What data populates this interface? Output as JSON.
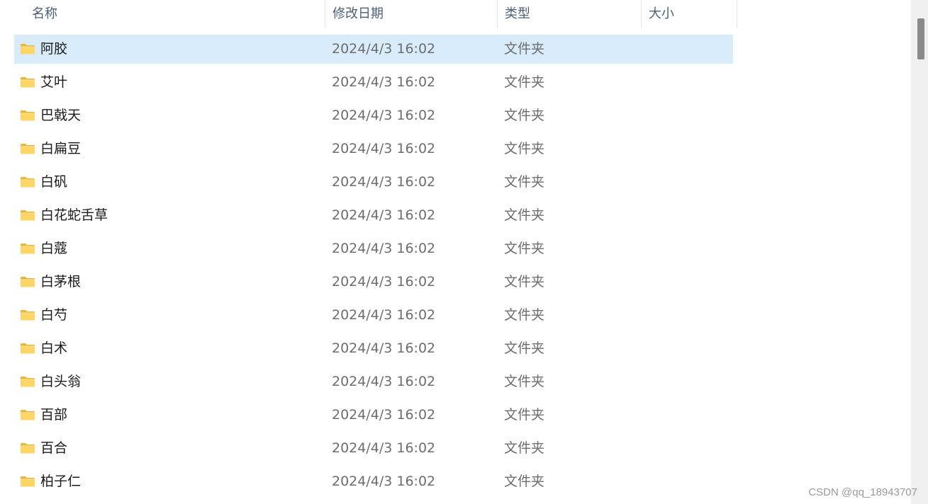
{
  "columns": {
    "name": "名称",
    "date": "修改日期",
    "type": "类型",
    "size": "大小"
  },
  "sort_indicator": "^",
  "rows": [
    {
      "name": "阿胶",
      "date": "2024/4/3 16:02",
      "type": "文件夹",
      "selected": true
    },
    {
      "name": "艾叶",
      "date": "2024/4/3 16:02",
      "type": "文件夹"
    },
    {
      "name": "巴戟天",
      "date": "2024/4/3 16:02",
      "type": "文件夹"
    },
    {
      "name": "白扁豆",
      "date": "2024/4/3 16:02",
      "type": "文件夹"
    },
    {
      "name": "白矾",
      "date": "2024/4/3 16:02",
      "type": "文件夹"
    },
    {
      "name": "白花蛇舌草",
      "date": "2024/4/3 16:02",
      "type": "文件夹"
    },
    {
      "name": "白蔻",
      "date": "2024/4/3 16:02",
      "type": "文件夹"
    },
    {
      "name": "白茅根",
      "date": "2024/4/3 16:02",
      "type": "文件夹"
    },
    {
      "name": "白芍",
      "date": "2024/4/3 16:02",
      "type": "文件夹"
    },
    {
      "name": "白术",
      "date": "2024/4/3 16:02",
      "type": "文件夹"
    },
    {
      "name": "白头翁",
      "date": "2024/4/3 16:02",
      "type": "文件夹"
    },
    {
      "name": "百部",
      "date": "2024/4/3 16:02",
      "type": "文件夹"
    },
    {
      "name": "百合",
      "date": "2024/4/3 16:02",
      "type": "文件夹"
    },
    {
      "name": "柏子仁",
      "date": "2024/4/3 16:02",
      "type": "文件夹"
    }
  ],
  "icons": {
    "folder": "folder-icon"
  },
  "colors": {
    "selected_row": "#d9ecfc",
    "header_text": "#4c607a",
    "folder_yellow": "#f5c542"
  },
  "watermark": "CSDN @qq_18943707"
}
